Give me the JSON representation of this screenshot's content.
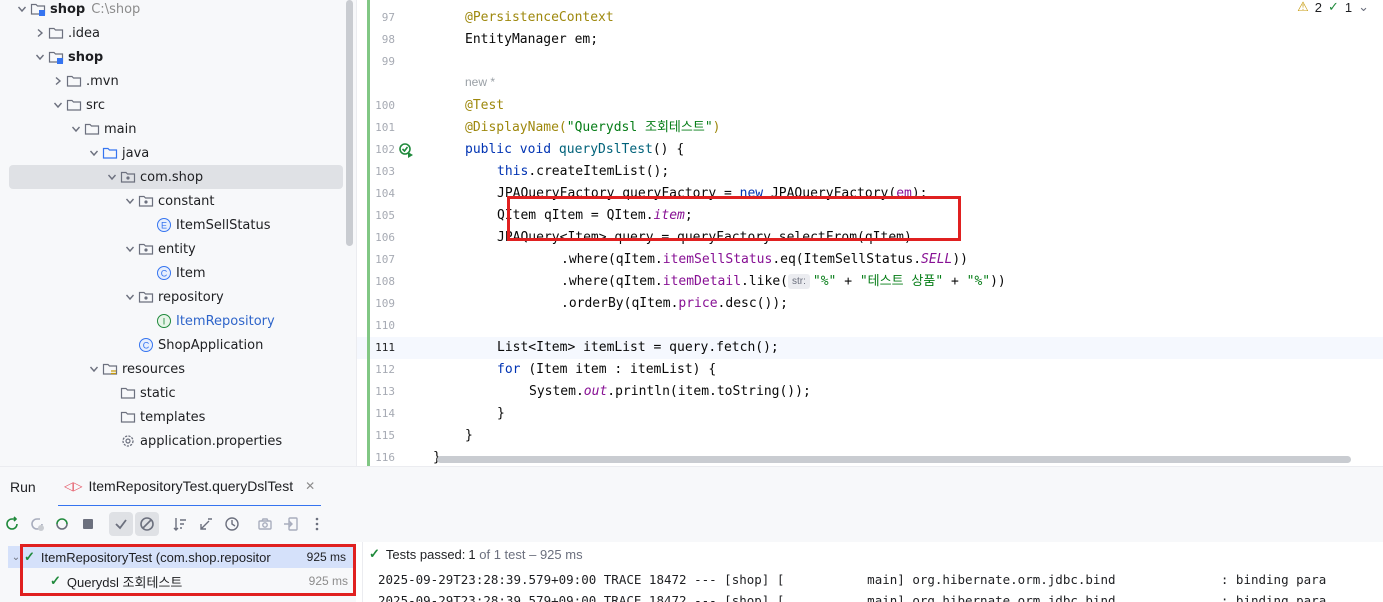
{
  "tree": {
    "items": [
      {
        "label": "shop",
        "path": "C:\\shop",
        "depth": 0,
        "expanded": true,
        "icon": "module-folder-icon",
        "bold": true
      },
      {
        "label": ".idea",
        "depth": 1,
        "expanded": false,
        "icon": "folder-icon"
      },
      {
        "label": "shop",
        "depth": 1,
        "expanded": true,
        "icon": "module-folder-icon",
        "bold": true
      },
      {
        "label": ".mvn",
        "depth": 2,
        "expanded": false,
        "icon": "folder-icon"
      },
      {
        "label": "src",
        "depth": 2,
        "expanded": true,
        "icon": "folder-icon"
      },
      {
        "label": "main",
        "depth": 3,
        "expanded": true,
        "icon": "folder-icon"
      },
      {
        "label": "java",
        "depth": 4,
        "expanded": true,
        "icon": "source-folder-icon"
      },
      {
        "label": "com.shop",
        "depth": 5,
        "expanded": true,
        "icon": "package-icon",
        "selected": true
      },
      {
        "label": "constant",
        "depth": 6,
        "expanded": true,
        "icon": "package-icon"
      },
      {
        "label": "ItemSellStatus",
        "depth": 7,
        "icon": "enum-icon"
      },
      {
        "label": "entity",
        "depth": 6,
        "expanded": true,
        "icon": "package-icon"
      },
      {
        "label": "Item",
        "depth": 7,
        "icon": "class-icon"
      },
      {
        "label": "repository",
        "depth": 6,
        "expanded": true,
        "icon": "package-icon"
      },
      {
        "label": "ItemRepository",
        "depth": 7,
        "icon": "interface-icon",
        "blue": true
      },
      {
        "label": "ShopApplication",
        "depth": 6,
        "icon": "class-icon"
      },
      {
        "label": "resources",
        "depth": 4,
        "expanded": true,
        "icon": "resources-folder-icon"
      },
      {
        "label": "static",
        "depth": 5,
        "icon": "folder-icon"
      },
      {
        "label": "templates",
        "depth": 5,
        "icon": "folder-icon"
      },
      {
        "label": "application.properties",
        "depth": 5,
        "icon": "settings-file-icon"
      }
    ]
  },
  "editor": {
    "warnings": "2",
    "checks": "1",
    "hint_new": "new *",
    "current_line": "111",
    "lines": [
      {
        "n": "97",
        "html_key": "l97"
      },
      {
        "n": "98",
        "html_key": "l98"
      },
      {
        "n": "99",
        "html_key": "l99"
      },
      {
        "n": "100",
        "html_key": "l100"
      },
      {
        "n": "101",
        "html_key": "l101"
      },
      {
        "n": "102",
        "html_key": "l102"
      },
      {
        "n": "103",
        "html_key": "l103"
      },
      {
        "n": "104",
        "html_key": "l104"
      },
      {
        "n": "105",
        "html_key": "l105"
      },
      {
        "n": "106",
        "html_key": "l106"
      },
      {
        "n": "107",
        "html_key": "l107"
      },
      {
        "n": "108",
        "html_key": "l108"
      },
      {
        "n": "109",
        "html_key": "l109"
      },
      {
        "n": "110",
        "html_key": "l110"
      },
      {
        "n": "111",
        "html_key": "l111"
      },
      {
        "n": "112",
        "html_key": "l112"
      },
      {
        "n": "113",
        "html_key": "l113"
      },
      {
        "n": "114",
        "html_key": "l114"
      },
      {
        "n": "115",
        "html_key": "l115"
      },
      {
        "n": "116",
        "html_key": "l116"
      }
    ],
    "code": {
      "l97": "@PersistenceContext",
      "l98": "EntityManager em;",
      "l100": "@Test",
      "l101a": "@DisplayName(",
      "l101b": "\"Querydsl 조회테스트\"",
      "l101c": ")",
      "l102a": "public void ",
      "l102b": "queryDslTest",
      "l102c": "() {",
      "l103a": "this",
      "l103b": ".createItemList();",
      "l104a": "JPAQueryFactory queryFactory = ",
      "l104b": "new ",
      "l104c": "JPAQueryFactory(",
      "l104d": "em",
      "l104e": ");",
      "l105a": "QItem qItem = QItem.",
      "l105b": "item",
      "l105c": ";",
      "l106": "JPAQuery<Item> query = queryFactory.selectFrom(qItem)",
      "l107a": ".where(qItem.",
      "l107b": "itemSellStatus",
      "l107c": ".eq(ItemSellStatus.",
      "l107d": "SELL",
      "l107e": "))",
      "l108a": ".where(qItem.",
      "l108b": "itemDetail",
      "l108c": ".like(",
      "l108pill": "str:",
      "l108d": "\"%\"",
      "l108e": " + ",
      "l108f": "\"테스트 상품\"",
      "l108g": " + ",
      "l108h": "\"%\"",
      "l108i": "))",
      "l109a": ".orderBy(qItem.",
      "l109b": "price",
      "l109c": ".desc());",
      "l111": "List<Item> itemList = query.fetch();",
      "l112a": "for ",
      "l112b": "(Item item : itemList) {",
      "l113a": "System.",
      "l113b": "out",
      "l113c": ".println(item.toString());",
      "l114": "}",
      "l115": "}",
      "l116": "}"
    }
  },
  "run": {
    "title": "Run",
    "tab_label": "ItemRepositoryTest.queryDslTest",
    "results": [
      {
        "label": "ItemRepositoryTest (com.shop.repositor",
        "time": "925 ms"
      },
      {
        "label": "Querydsl 조회테스트",
        "time": "925 ms"
      }
    ],
    "status_prefix": "Tests passed: ",
    "status_count": "1",
    "status_suffix": " of 1 test – 925 ms",
    "log": [
      "2025-09-29T23:28:39.579+09:00 TRACE 18472 --- [shop] [           main] org.hibernate.orm.jdbc.bind              : binding para",
      "2025-09-29T23:28:39.579+09:00 TRACE 18472 --- [shop] [           main] org.hibernate.orm.jdbc.bind              : binding para"
    ]
  }
}
